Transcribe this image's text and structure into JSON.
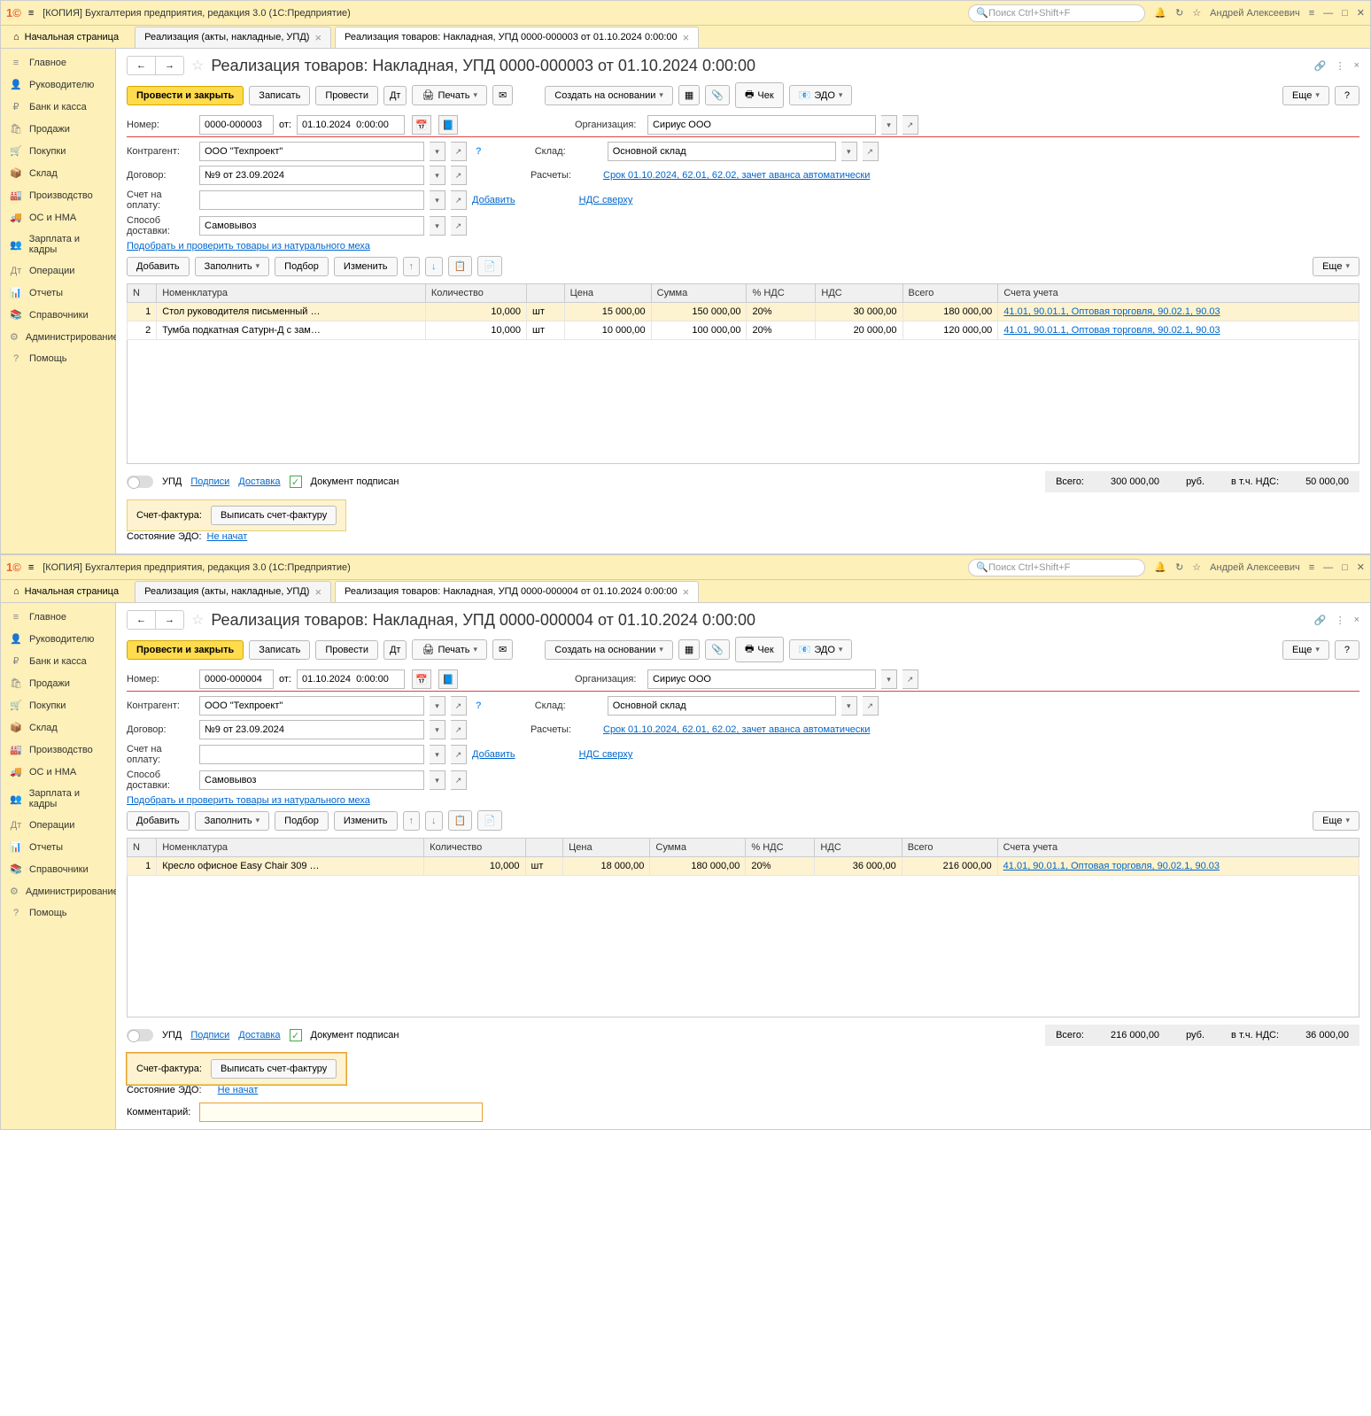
{
  "app": {
    "title": "[КОПИЯ] Бухгалтерия предприятия, редакция 3.0  (1С:Предприятие)",
    "search_ph": "Поиск Ctrl+Shift+F",
    "user": "Андрей Алексеевич",
    "home": "Начальная страница"
  },
  "sidebar": [
    {
      "icon": "≡",
      "label": "Главное"
    },
    {
      "icon": "👤",
      "label": "Руководителю"
    },
    {
      "icon": "₽",
      "label": "Банк и касса"
    },
    {
      "icon": "🛍",
      "label": "Продажи"
    },
    {
      "icon": "🛒",
      "label": "Покупки"
    },
    {
      "icon": "📦",
      "label": "Склад"
    },
    {
      "icon": "🏭",
      "label": "Производство"
    },
    {
      "icon": "🚚",
      "label": "ОС и НМА"
    },
    {
      "icon": "👥",
      "label": "Зарплата и кадры"
    },
    {
      "icon": "Дт",
      "label": "Операции"
    },
    {
      "icon": "📊",
      "label": "Отчеты"
    },
    {
      "icon": "📚",
      "label": "Справочники"
    },
    {
      "icon": "⚙",
      "label": "Администрирование"
    },
    {
      "icon": "?",
      "label": "Помощь"
    }
  ],
  "tabs_list": {
    "t1": "Реализация (акты, накладные, УПД)"
  },
  "common": {
    "toolbar": {
      "post_close": "Провести и закрыть",
      "save": "Записать",
      "post": "Провести",
      "print": "Печать",
      "create_based": "Создать на основании",
      "check": "Чек",
      "edo": "ЭДО",
      "more": "Еще",
      "help": "?"
    },
    "form": {
      "number": "Номер:",
      "from": "от:",
      "org": "Организация:",
      "contr": "Контрагент:",
      "wh": "Склад:",
      "contract": "Договор:",
      "calc": "Расчеты:",
      "invoice": "Счет на оплату:",
      "add_link": "Добавить",
      "vat": "НДС сверху",
      "delivery": "Способ доставки:",
      "fur_link": "Подобрать и проверить товары из натурального меха"
    },
    "tbl_toolbar": {
      "add": "Добавить",
      "fill": "Заполнить",
      "select": "Подбор",
      "change": "Изменить",
      "more": "Еще"
    },
    "cols": {
      "n": "N",
      "nom": "Номенклатура",
      "qty": "Количество",
      "price": "Цена",
      "sum": "Сумма",
      "vat_pct": "% НДС",
      "vat": "НДС",
      "total": "Всего",
      "acc": "Счета учета"
    },
    "footer": {
      "upd": "УПД",
      "sign": "Подписи",
      "deliv": "Доставка",
      "signed": "Документ подписан",
      "total": "Всего:",
      "curr": "руб.",
      "inc_vat": "в т.ч. НДС:"
    },
    "sf": {
      "label": "Счет-фактура:",
      "btn": "Выписать счет-фактуру",
      "edo_state": "Состояние ЭДО:",
      "not_started": "Не начат",
      "comment": "Комментарий:"
    }
  },
  "w1": {
    "tab": "Реализация товаров: Накладная, УПД 0000-000003 от 01.10.2024 0:00:00",
    "title": "Реализация товаров: Накладная, УПД 0000-000003 от 01.10.2024 0:00:00",
    "number": "0000-000003",
    "date": "01.10.2024  0:00:00",
    "org": "Сириус ООО",
    "contr": "ООО \"Техпроект\"",
    "wh": "Основной склад",
    "contract": "№9 от 23.09.2024",
    "calc_link": "Срок 01.10.2024, 62.01, 62.02, зачет аванса автоматически",
    "delivery": "Самовывоз",
    "rows": [
      {
        "n": "1",
        "nom": "Стол руководителя письменный …",
        "qty": "10,000",
        "unit": "шт",
        "price": "15 000,00",
        "sum": "150 000,00",
        "vat_pct": "20%",
        "vat": "30 000,00",
        "total": "180 000,00",
        "acc": "41.01, 90.01.1, Оптовая торговля, 90.02.1, 90.03"
      },
      {
        "n": "2",
        "nom": "Тумба подкатная Сатурн-Д с зам…",
        "qty": "10,000",
        "unit": "шт",
        "price": "10 000,00",
        "sum": "100 000,00",
        "vat_pct": "20%",
        "vat": "20 000,00",
        "total": "120 000,00",
        "acc": "41.01, 90.01.1, Оптовая торговля, 90.02.1, 90.03"
      }
    ],
    "grand_total": "300 000,00",
    "grand_vat": "50 000,00"
  },
  "w2": {
    "tab": "Реализация товаров: Накладная, УПД 0000-000004 от 01.10.2024 0:00:00",
    "title": "Реализация товаров: Накладная, УПД 0000-000004 от 01.10.2024 0:00:00",
    "number": "0000-000004",
    "date": "01.10.2024  0:00:00",
    "org": "Сириус ООО",
    "contr": "ООО \"Техпроект\"",
    "wh": "Основной склад",
    "contract": "№9 от 23.09.2024",
    "calc_link": "Срок 01.10.2024, 62.01, 62.02, зачет аванса автоматически",
    "delivery": "Самовывоз",
    "rows": [
      {
        "n": "1",
        "nom": "Кресло офисное Easy Chair 309 …",
        "qty": "10,000",
        "unit": "шт",
        "price": "18 000,00",
        "sum": "180 000,00",
        "vat_pct": "20%",
        "vat": "36 000,00",
        "total": "216 000,00",
        "acc": "41.01, 90.01.1, Оптовая торговля, 90.02.1, 90.03"
      }
    ],
    "grand_total": "216 000,00",
    "grand_vat": "36 000,00"
  }
}
